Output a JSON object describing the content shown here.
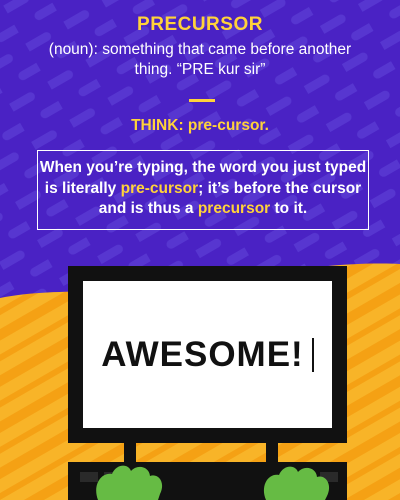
{
  "card": {
    "word": "PRECURSOR",
    "definition": "(noun): something that came before another thing. “PRE kur sir”",
    "think": "THINK: pre-cursor.",
    "explanation": {
      "part1": "When you’re typing, the word you just typed is literally ",
      "highlight1": "pre-cursor",
      "part2": "; it’s before the cursor and is thus a ",
      "highlight2": "precursor",
      "part3": " to it."
    },
    "screen_text": "AWESOME!"
  },
  "colors": {
    "purple_bg": "#4a22c4",
    "purple_stripe": "#5a3ad0",
    "yellow_bg": "#f8b428",
    "yellow_stripe": "#f6a417",
    "accent_yellow": "#ffd23a",
    "monitor_frame": "#111111",
    "keyboard_green": "#66bb44"
  },
  "icons": [
    "monitor-icon",
    "keyboard-icon",
    "hand-icon"
  ]
}
